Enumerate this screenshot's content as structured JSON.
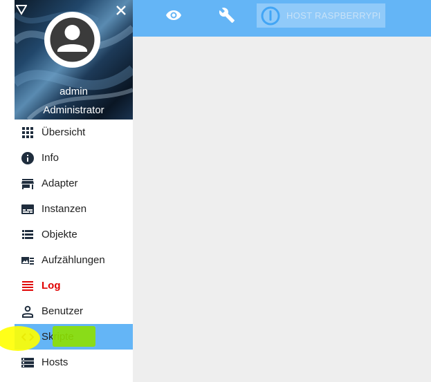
{
  "topbar": {
    "icons": [
      "eye-icon",
      "wrench-icon",
      "power-icon"
    ],
    "host_button_label": "HOST RASPBERRYPI",
    "colors": {
      "bar": "#64b5f6",
      "host_button": "#90caf9"
    }
  },
  "drawer": {
    "logo_icon": "triangle-logo-icon",
    "close_icon": "close-icon",
    "user": {
      "name": "admin",
      "role": "Administrator",
      "avatar_icon": "account-icon"
    },
    "items": [
      {
        "label": "Übersicht",
        "icon": "apps-icon"
      },
      {
        "label": "Info",
        "icon": "info-icon"
      },
      {
        "label": "Adapter",
        "icon": "store-icon"
      },
      {
        "label": "Instanzen",
        "icon": "subtitles-icon"
      },
      {
        "label": "Objekte",
        "icon": "list-icon"
      },
      {
        "label": "Aufzählungen",
        "icon": "featured-list-icon"
      },
      {
        "label": "Log",
        "icon": "log-lines-icon",
        "color": "#e00000"
      },
      {
        "label": "Benutzer",
        "icon": "person-icon"
      },
      {
        "label": "Skripte",
        "icon": "code-icon",
        "active": true
      },
      {
        "label": "Hosts",
        "icon": "storage-icon"
      }
    ],
    "active_color": "#64b5f6"
  }
}
